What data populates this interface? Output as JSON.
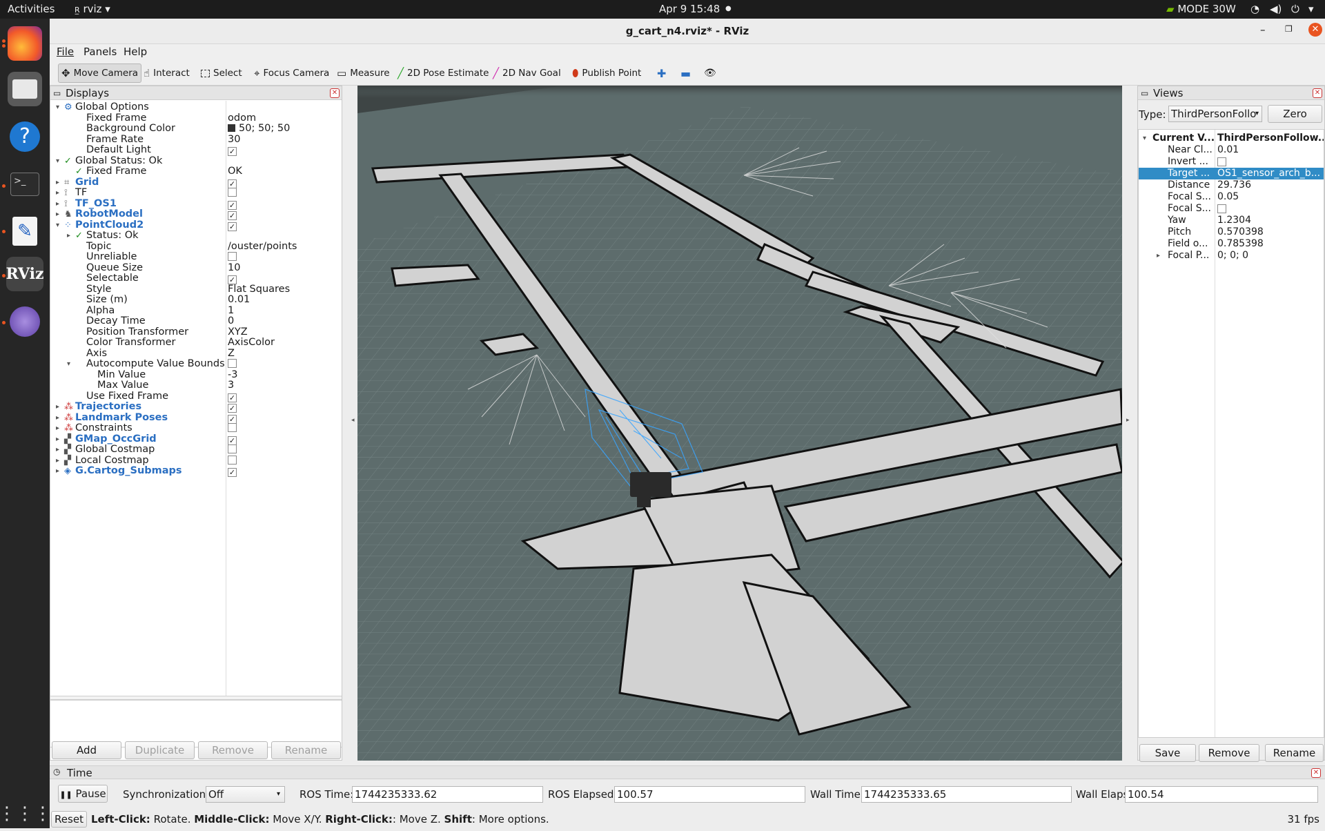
{
  "topbar": {
    "activities": "Activities",
    "app": "rviz",
    "clock": "Apr 9  15:48",
    "power_mode": "MODE 30W"
  },
  "window": {
    "title": "g_cart_n4.rviz* - RViz"
  },
  "menu": [
    "File",
    "Panels",
    "Help"
  ],
  "toolbar": {
    "tools": [
      {
        "label": "Move Camera",
        "icon": "move-camera-icon"
      },
      {
        "label": "Interact",
        "icon": "interact-icon"
      },
      {
        "label": "Select",
        "icon": "select-icon"
      },
      {
        "label": "Focus Camera",
        "icon": "focus-camera-icon"
      },
      {
        "label": "Measure",
        "icon": "measure-icon"
      },
      {
        "label": "2D Pose Estimate",
        "icon": "pose-estimate-icon"
      },
      {
        "label": "2D Nav Goal",
        "icon": "nav-goal-icon"
      },
      {
        "label": "Publish Point",
        "icon": "publish-point-icon"
      }
    ]
  },
  "displays": {
    "title": "Displays",
    "rows": [
      {
        "name": "Global Options",
        "value": "",
        "indent": 0,
        "expand": "open",
        "icon": "gear"
      },
      {
        "name": "Fixed Frame",
        "value": "odom",
        "indent": 1
      },
      {
        "name": "Background Color",
        "value": "50; 50; 50",
        "indent": 1,
        "swatch": "#323232"
      },
      {
        "name": "Frame Rate",
        "value": "30",
        "indent": 1
      },
      {
        "name": "Default Light",
        "value": "",
        "indent": 1,
        "check": true
      },
      {
        "name": "Global Status: Ok",
        "value": "",
        "indent": 0,
        "expand": "open",
        "icon": "ok"
      },
      {
        "name": "Fixed Frame",
        "value": "OK",
        "indent": 1,
        "icon": "ok"
      },
      {
        "name": "Grid",
        "value": "",
        "indent": 0,
        "expand": "closed",
        "icon": "grid",
        "blue": true,
        "check": true
      },
      {
        "name": "TF",
        "value": "",
        "indent": 0,
        "expand": "closed",
        "icon": "tf",
        "check": false
      },
      {
        "name": "TF_OS1",
        "value": "",
        "indent": 0,
        "expand": "closed",
        "icon": "tf",
        "blue": true,
        "check": true
      },
      {
        "name": "RobotModel",
        "value": "",
        "indent": 0,
        "expand": "closed",
        "icon": "robot",
        "blue": true,
        "check": true
      },
      {
        "name": "PointCloud2",
        "value": "",
        "indent": 0,
        "expand": "open",
        "icon": "cloud",
        "blue": true,
        "check": true
      },
      {
        "name": "Status: Ok",
        "value": "",
        "indent": 1,
        "expand": "closed",
        "icon": "ok"
      },
      {
        "name": "Topic",
        "value": "/ouster/points",
        "indent": 1
      },
      {
        "name": "Unreliable",
        "value": "",
        "indent": 1,
        "check": false
      },
      {
        "name": "Queue Size",
        "value": "10",
        "indent": 1
      },
      {
        "name": "Selectable",
        "value": "",
        "indent": 1,
        "check": true
      },
      {
        "name": "Style",
        "value": "Flat Squares",
        "indent": 1
      },
      {
        "name": "Size (m)",
        "value": "0.01",
        "indent": 1
      },
      {
        "name": "Alpha",
        "value": "1",
        "indent": 1
      },
      {
        "name": "Decay Time",
        "value": "0",
        "indent": 1
      },
      {
        "name": "Position Transformer",
        "value": "XYZ",
        "indent": 1
      },
      {
        "name": "Color Transformer",
        "value": "AxisColor",
        "indent": 1
      },
      {
        "name": "Axis",
        "value": "Z",
        "indent": 1
      },
      {
        "name": "Autocompute Value Bounds",
        "value": "",
        "indent": 1,
        "expand": "open",
        "check": false
      },
      {
        "name": "Min Value",
        "value": "-3",
        "indent": 2
      },
      {
        "name": "Max Value",
        "value": "3",
        "indent": 2
      },
      {
        "name": "Use Fixed Frame",
        "value": "",
        "indent": 1,
        "check": true
      },
      {
        "name": "Trajectories",
        "value": "",
        "indent": 0,
        "expand": "closed",
        "icon": "marker",
        "blue": true,
        "check": true
      },
      {
        "name": "Landmark Poses",
        "value": "",
        "indent": 0,
        "expand": "closed",
        "icon": "marker",
        "blue": true,
        "check": true
      },
      {
        "name": "Constraints",
        "value": "",
        "indent": 0,
        "expand": "closed",
        "icon": "marker",
        "check": false
      },
      {
        "name": "GMap_OccGrid",
        "value": "",
        "indent": 0,
        "expand": "closed",
        "icon": "map",
        "blue": true,
        "check": true
      },
      {
        "name": "Global Costmap",
        "value": "",
        "indent": 0,
        "expand": "closed",
        "icon": "map",
        "check": false
      },
      {
        "name": "Local Costmap",
        "value": "",
        "indent": 0,
        "expand": "closed",
        "icon": "map",
        "check": false
      },
      {
        "name": "G.Cartog_Submaps",
        "value": "",
        "indent": 0,
        "expand": "closed",
        "icon": "submap",
        "blue": true,
        "check": true
      }
    ],
    "buttons": {
      "add": "Add",
      "duplicate": "Duplicate",
      "remove": "Remove",
      "rename": "Rename"
    }
  },
  "views": {
    "title": "Views",
    "type_label": "Type:",
    "type_value": "ThirdPersonFollo",
    "zero": "Zero",
    "rows": [
      {
        "name": "Current V...",
        "value": "ThirdPersonFollow...",
        "header": true
      },
      {
        "name": "Near Cl...",
        "value": "0.01"
      },
      {
        "name": "Invert ...",
        "value": "",
        "check": false
      },
      {
        "name": "Target ...",
        "value": "OS1_sensor_arch_b...",
        "selected": true
      },
      {
        "name": "Distance",
        "value": "29.736"
      },
      {
        "name": "Focal S...",
        "value": "0.05"
      },
      {
        "name": "Focal S...",
        "value": "",
        "check": false
      },
      {
        "name": "Yaw",
        "value": "1.2304"
      },
      {
        "name": "Pitch",
        "value": "0.570398"
      },
      {
        "name": "Field o...",
        "value": "0.785398"
      },
      {
        "name": "Focal P...",
        "value": "0; 0; 0",
        "expand": true
      }
    ],
    "buttons": {
      "save": "Save",
      "remove": "Remove",
      "rename": "Rename"
    }
  },
  "time": {
    "title": "Time",
    "pause": "Pause",
    "sync_label": "Synchronization:",
    "sync_value": "Off",
    "ros_time_label": "ROS Time:",
    "ros_time": "1744235333.62",
    "ros_elapsed_label": "ROS Elapsed:",
    "ros_elapsed": "100.57",
    "wall_time_label": "Wall Time:",
    "wall_time": "1744235333.65",
    "wall_elapsed_label": "Wall Elapsed:",
    "wall_elapsed": "100.54"
  },
  "statusbar": {
    "reset": "Reset",
    "hint": [
      {
        "b": "Left-Click:",
        "t": " Rotate. "
      },
      {
        "b": "Middle-Click:",
        "t": " Move X/Y. "
      },
      {
        "b": "Right-Click:",
        "t": ": Move Z. "
      },
      {
        "b": "Shift",
        "t": ": More options."
      }
    ],
    "fps": "31 fps"
  },
  "colors": {
    "viewport_bg": "#5d6c6c",
    "grid": "#7e8c8c",
    "map_free": "#cfcfcf",
    "selection": "#308cc6",
    "accent_blue": "#2b6fc2"
  }
}
